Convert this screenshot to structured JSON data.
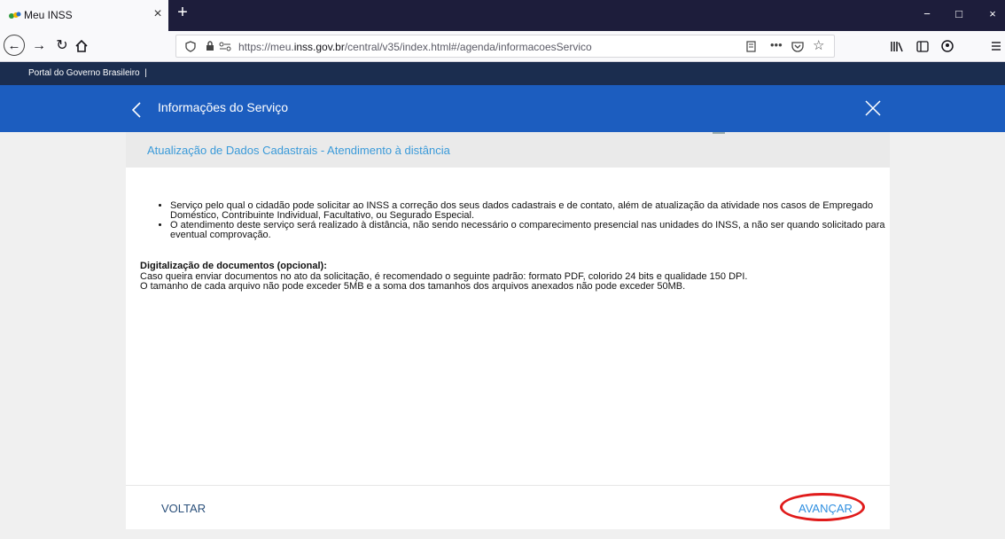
{
  "browser": {
    "tab_title": "Meu INSS",
    "tab_close": "×",
    "new_tab": "+",
    "url_prefix": "https://meu.",
    "url_domain": "inss.gov.br",
    "url_path": "/central/v35/index.html#/agenda/informacoesServico",
    "window_controls": [
      "−",
      "□",
      "×"
    ]
  },
  "gov_bar": {
    "text": "Portal do Governo Brasileiro"
  },
  "header": {
    "title": "Informações do Serviço"
  },
  "card": {
    "title": "Atualização de Dados Cadastrais - Atendimento à distância",
    "bullets": [
      "Serviço pelo qual o cidadão pode solicitar ao INSS a correção dos seus dados cadastrais e de contato, além de atualização da atividade nos casos de Empregado Doméstico, Contribuinte Individual, Facultativo, ou Segurado Especial.",
      "O atendimento deste serviço será realizado à distância, não sendo necessário o comparecimento presencial nas unidades do INSS, a não ser quando solicitado para eventual comprovação."
    ],
    "digitalization_title": "Digitalização de documentos (opcional):",
    "digitalization_lines": [
      "Caso queira enviar documentos no ato da solicitação, é recomendado o seguinte padrão: formato PDF, colorido 24 bits e qualidade 150 DPI.",
      "O tamanho de cada arquivo não pode exceder 5MB e a soma dos tamanhos dos arquivos anexados não pode exceder 50MB."
    ]
  },
  "footer": {
    "back_label": "VOLTAR",
    "next_label": "AVANÇAR"
  }
}
